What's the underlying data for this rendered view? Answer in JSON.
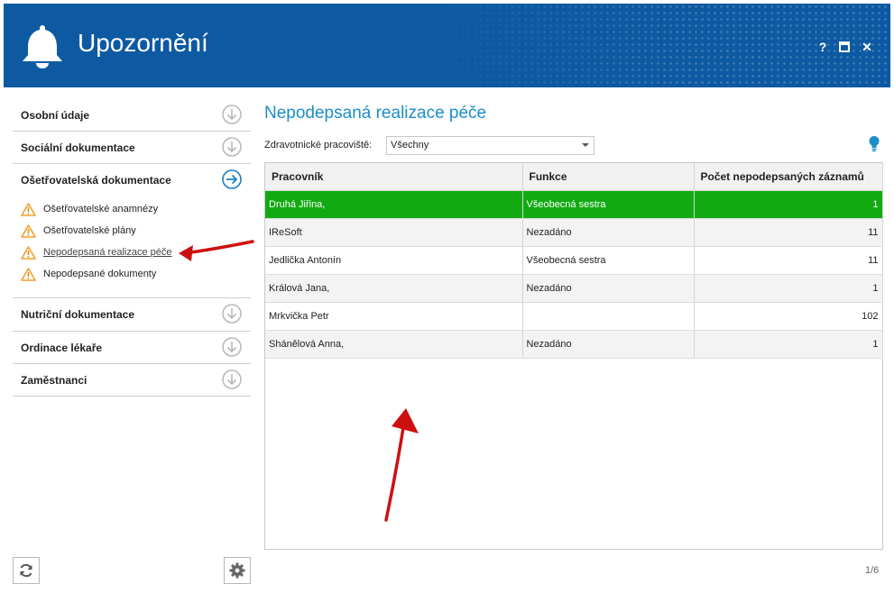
{
  "window": {
    "title": "Upozornění",
    "help_label": "?",
    "close_label": "✕"
  },
  "sidebar": {
    "sections": [
      {
        "label": "Osobní údaje",
        "icon": "arrow-down-circle-icon"
      },
      {
        "label": "Sociální dokumentace",
        "icon": "arrow-down-circle-icon"
      },
      {
        "label": "Ošetřovatelská dokumentace",
        "icon": "arrow-right-circle-icon",
        "expanded": true
      },
      {
        "label": "Nutriční dokumentace",
        "icon": "arrow-down-circle-icon"
      },
      {
        "label": "Ordinace lékaře",
        "icon": "arrow-down-circle-icon"
      },
      {
        "label": "Zaměstnanci",
        "icon": "arrow-down-circle-icon"
      }
    ],
    "subitems": [
      {
        "label": "Ošetřovatelské anamnézy",
        "icon": "warning-icon"
      },
      {
        "label": "Ošetřovatelské plány",
        "icon": "warning-icon"
      },
      {
        "label": "Nepodepsaná realizace péče",
        "icon": "warning-icon",
        "active": true
      },
      {
        "label": "Nepodepsané dokumenty",
        "icon": "warning-icon"
      }
    ]
  },
  "main": {
    "title": "Nepodepsaná realizace péče",
    "filter_label": "Zdravotnické pracoviště:",
    "filter_value": "Všechny",
    "columns": [
      "Pracovník",
      "Funkce",
      "Počet nepodepsaných záznamů"
    ],
    "rows": [
      {
        "worker": "Druhá Jiřina,",
        "role": "Všeobecná sestra",
        "count": "1",
        "selected": true
      },
      {
        "worker": "IReSoft",
        "role": "Nezadáno",
        "count": "11"
      },
      {
        "worker": "Jedlička Antonín",
        "role": "Všeobecná sestra",
        "count": "11"
      },
      {
        "worker": "Králová Jana,",
        "role": "Nezadáno",
        "count": "1"
      },
      {
        "worker": "Mrkvička Petr",
        "role": "",
        "count": "102"
      },
      {
        "worker": "Shánělová Anna,",
        "role": "Nezadáno",
        "count": "1"
      }
    ]
  },
  "footer": {
    "pager": "1/6"
  },
  "colors": {
    "header_bg": "#0d5aa2",
    "title_accent": "#1b8ec9",
    "selected_row": "#12aa12",
    "warning": "#f0a030",
    "annotation_arrow": "#cc1010"
  }
}
